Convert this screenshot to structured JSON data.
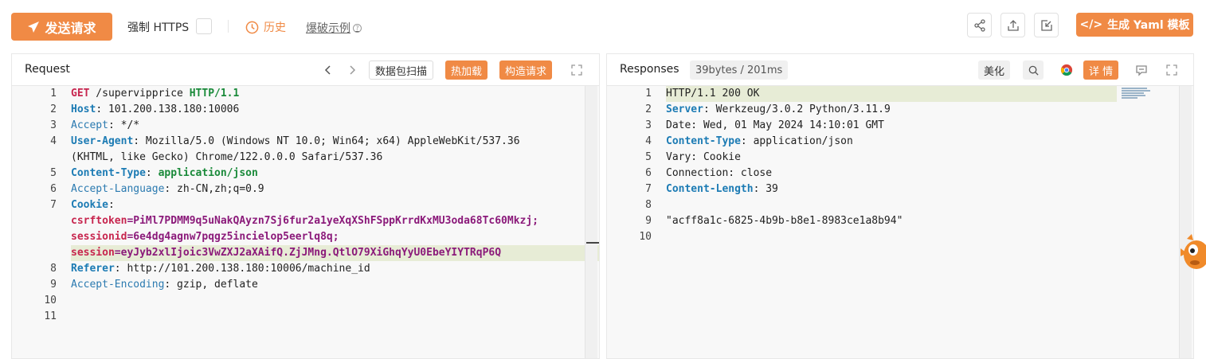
{
  "toolbar": {
    "send_label": "发送请求",
    "force_https_label": "强制 HTTPS",
    "history_label": "历史",
    "blast_label": "爆破示例",
    "yaml_label": "生成 Yaml 模板"
  },
  "request_panel": {
    "title": "Request",
    "scan_label": "数据包扫描",
    "hot_load_label": "热加载",
    "build_label": "构造请求",
    "lines": [
      {
        "n": "1",
        "parts": [
          {
            "t": "GET",
            "c": "k-red"
          },
          {
            "t": " /supervipprice ",
            "c": "k-plain"
          },
          {
            "t": "HTTP/1.1",
            "c": "k-green"
          }
        ]
      },
      {
        "n": "2",
        "parts": [
          {
            "t": "Host",
            "c": "k-blue"
          },
          {
            "t": ": 101.200.138.180:10006",
            "c": "k-plain"
          }
        ]
      },
      {
        "n": "3",
        "parts": [
          {
            "t": "Accept",
            "c": "k-blue-n"
          },
          {
            "t": ": */*",
            "c": "k-plain"
          }
        ]
      },
      {
        "n": "4",
        "parts": [
          {
            "t": "User-Agent",
            "c": "k-blue"
          },
          {
            "t": ": Mozilla/5.0 (Windows NT 10.0; Win64; x64) AppleWebKit/537.36",
            "c": "k-plain"
          }
        ]
      },
      {
        "n": "",
        "parts": [
          {
            "t": "(KHTML, like Gecko) Chrome/122.0.0.0 Safari/537.36",
            "c": "k-plain"
          }
        ]
      },
      {
        "n": "5",
        "parts": [
          {
            "t": "Content-Type",
            "c": "k-blue"
          },
          {
            "t": ": ",
            "c": "k-plain"
          },
          {
            "t": "application/json",
            "c": "k-green"
          }
        ]
      },
      {
        "n": "6",
        "parts": [
          {
            "t": "Accept-Language",
            "c": "k-blue-n"
          },
          {
            "t": ": zh-CN,zh;q=0.9",
            "c": "k-plain"
          }
        ]
      },
      {
        "n": "7",
        "parts": [
          {
            "t": "Cookie",
            "c": "k-blue"
          },
          {
            "t": ":",
            "c": "k-plain"
          }
        ]
      },
      {
        "n": "",
        "parts": [
          {
            "t": "csrftoken",
            "c": "k-red"
          },
          {
            "t": "=PiMl7PDMM9q5uNakQAyzn7Sj6fur2a1yeXqXShFSppKrrdKxMU3oda68Tc60Mkzj;",
            "c": "k-purple"
          }
        ]
      },
      {
        "n": "",
        "parts": [
          {
            "t": "sessionid",
            "c": "k-red"
          },
          {
            "t": "=6e4dg4agnw7pqgz5incielop5eerlq8q;",
            "c": "k-purple"
          }
        ]
      },
      {
        "n": "",
        "parts": [
          {
            "t": "session",
            "c": "k-red"
          },
          {
            "t": "=eyJyb2xlIjoic3VwZXJ2aXAifQ.ZjJMng.QtlO79XiGhqYyU0EbeYIYTRqP6Q",
            "c": "k-purple"
          }
        ]
      },
      {
        "n": "8",
        "parts": [
          {
            "t": "Referer",
            "c": "k-blue"
          },
          {
            "t": ": http://101.200.138.180:10006/machine_id",
            "c": "k-plain"
          }
        ]
      },
      {
        "n": "9",
        "parts": [
          {
            "t": "Accept-Encoding",
            "c": "k-blue-n"
          },
          {
            "t": ": gzip, deflate",
            "c": "k-plain"
          }
        ]
      },
      {
        "n": "10",
        "parts": []
      },
      {
        "n": "11",
        "parts": []
      }
    ]
  },
  "response_panel": {
    "title": "Responses",
    "size_badge": "39bytes / 201ms",
    "beautify_label": "美化",
    "detail_label": "详 情",
    "lines": [
      {
        "n": "1",
        "parts": [
          {
            "t": "HTTP/1.1 200 OK",
            "c": "k-plain"
          }
        ]
      },
      {
        "n": "2",
        "parts": [
          {
            "t": "Server",
            "c": "k-blue"
          },
          {
            "t": ": Werkzeug/3.0.2 Python/3.11.9",
            "c": "k-plain"
          }
        ]
      },
      {
        "n": "3",
        "parts": [
          {
            "t": "Date: Wed, 01 May 2024 14:10:01 GMT",
            "c": "k-plain"
          }
        ]
      },
      {
        "n": "4",
        "parts": [
          {
            "t": "Content-Type",
            "c": "k-blue"
          },
          {
            "t": ": application/json",
            "c": "k-plain"
          }
        ]
      },
      {
        "n": "5",
        "parts": [
          {
            "t": "Vary: Cookie",
            "c": "k-plain"
          }
        ]
      },
      {
        "n": "6",
        "parts": [
          {
            "t": "Connection: close",
            "c": "k-plain"
          }
        ]
      },
      {
        "n": "7",
        "parts": [
          {
            "t": "Content-Length",
            "c": "k-blue"
          },
          {
            "t": ": 39",
            "c": "k-plain"
          }
        ]
      },
      {
        "n": "8",
        "parts": []
      },
      {
        "n": "9",
        "parts": [
          {
            "t": "\"acff8a1c-6825-4b9b-b8e1-8983ce1a8b94\"",
            "c": "k-plain"
          }
        ]
      },
      {
        "n": "10",
        "parts": []
      }
    ]
  },
  "colors": {
    "accent": "#f08a45",
    "highlight": "#e7ecd6"
  }
}
